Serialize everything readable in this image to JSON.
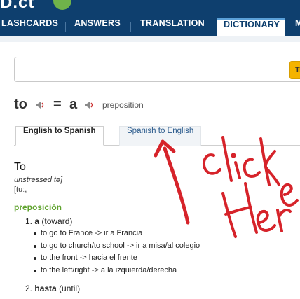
{
  "logo": {
    "text": "D.ct"
  },
  "nav": {
    "items": [
      {
        "label": "LASHCARDS",
        "active": false
      },
      {
        "label": "ANSWERS",
        "active": false
      },
      {
        "label": "TRANSLATION",
        "active": false
      },
      {
        "label": "DICTIONARY",
        "active": true
      },
      {
        "label": "M",
        "active": false
      }
    ]
  },
  "search": {
    "value": "",
    "button_label": "Tr"
  },
  "headline": {
    "source_word": "to",
    "equals": "=",
    "target_word": "a",
    "part_of_speech": "preposition"
  },
  "direction_tabs": {
    "active": "English to Spanish",
    "inactive": "Spanish to English"
  },
  "entry": {
    "word": "To",
    "note": "unstressed tə]",
    "phonetic": "[tuː,",
    "pos_heading": "preposición",
    "senses": [
      {
        "number": "1.",
        "translation": "a",
        "gloss": "(toward)",
        "examples": [
          "to go to France -> ir a Francia",
          "to go to church/to school -> ir a misa/al colegio",
          "to the front -> hacia el frente",
          "to the left/right -> a la izquierda/derecha"
        ]
      },
      {
        "number": "2.",
        "translation": "hasta",
        "gloss": "(until)",
        "examples": []
      }
    ]
  },
  "annotation": {
    "text": "click Here",
    "color": "#d6232a"
  },
  "colors": {
    "nav_bg": "#0e3f6e",
    "accent_green": "#5ea22c",
    "search_button": "#f5b300",
    "link_blue": "#2a5a8c"
  }
}
